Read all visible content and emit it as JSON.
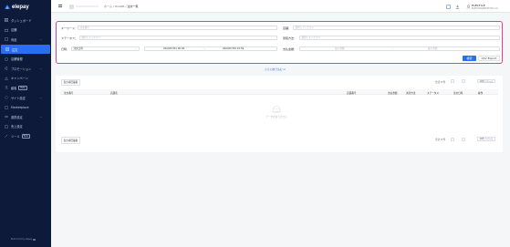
{
  "brand": {
    "name": "elepay",
    "color": "#2b6ef2"
  },
  "sidebar": {
    "items": [
      {
        "label": "ダッシュボード",
        "icon": "dashboard-icon"
      },
      {
        "label": "店舗",
        "icon": "store-icon"
      },
      {
        "label": "商品",
        "icon": "product-icon",
        "chevron": "⌄"
      },
      {
        "label": "注文",
        "icon": "order-icon",
        "active": true
      },
      {
        "label": "店舗管理",
        "icon": "shop-manage-icon"
      },
      {
        "label": "プロモーション",
        "icon": "promotion-icon",
        "chevron": "⌄"
      },
      {
        "label": "キャンペーン",
        "icon": "campaign-icon"
      },
      {
        "label": "顧客",
        "icon": "customer-icon",
        "tag": "Beta"
      },
      {
        "label": "サイト設定",
        "icon": "site-setting-icon",
        "chevron": "⌄"
      },
      {
        "label": "Marketplace",
        "icon": "marketplace-icon"
      },
      {
        "label": "連携設定",
        "icon": "integration-icon",
        "chevron": "⌄"
      },
      {
        "label": "売上設定",
        "icon": "sales-setting-icon"
      },
      {
        "label": "ツール",
        "icon": "tool-icon",
        "tag": "Beta"
      }
    ],
    "footer": "Build 2.0.0 by elepay"
  },
  "topbar": {
    "crumb_home": "ホーム",
    "crumb_sep1": "/",
    "crumb_app": "OneQR",
    "crumb_sep2": "/",
    "crumb_current": "注文一覧",
    "user_name": "ELESTYLE",
    "user_id": "ELESTYLE@ELESTYLE.com"
  },
  "filters": {
    "keyword_label": "キーワード：",
    "keyword_placeholder": "注文番号",
    "store_label": "店舗：",
    "store_placeholder": "選択してください",
    "status_label": "ステータス：",
    "status_placeholder": "選択してください",
    "payment_label": "受取方法：",
    "payment_placeholder": "選択してください",
    "date_label": "日時：",
    "date_type": "注文日時",
    "date_from": "2020/07/01 00:00",
    "date_sep": "~",
    "date_to": "2020/07/09 23:59",
    "amount_label": "支払金額：",
    "amount_min_placeholder": "最小金額",
    "amount_sep": "~",
    "amount_max_placeholder": "最大金額",
    "search_button": "検索",
    "csv_button": "CSV Export",
    "more_filter": "さらに絞り込む ⊡"
  },
  "table": {
    "column_button": "表示項目編集",
    "total": "合計 0 件",
    "page_size": "10件 / ページ",
    "headers": [
      "注文番号",
      "店舗名",
      "店舗番号",
      "支払金額",
      "決済方法",
      "ステータス",
      "注文日時",
      "操作"
    ],
    "empty_text": "データがありません"
  }
}
